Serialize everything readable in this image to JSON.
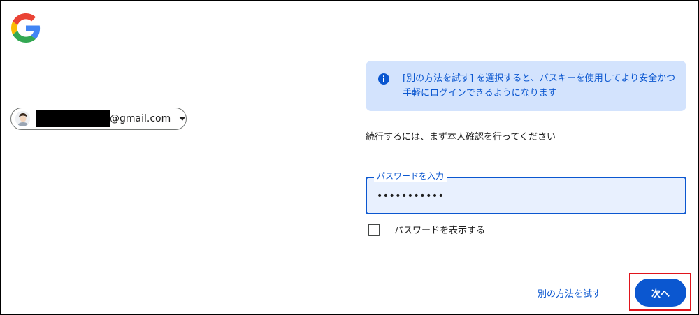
{
  "account": {
    "email_suffix": "@gmail.com",
    "avatar_icon": "user-avatar-icon",
    "dropdown_icon": "chevron-down-icon"
  },
  "info": {
    "icon": "info-icon",
    "text": "[別の方法を試す] を選択すると、パスキーを使用してより安全かつ手軽にログインできるようになります"
  },
  "subtitle": "続行するには、まず本人確認を行ってください",
  "password": {
    "label": "パスワードを入力",
    "value": "•••••••••••"
  },
  "show_password": {
    "label": "パスワードを表示する",
    "checked": false
  },
  "actions": {
    "try_another_label": "別の方法を試す",
    "next_label": "次へ"
  },
  "colors": {
    "accent": "#0b57d0",
    "info_bg": "#d3e3fd",
    "highlight": "#e0141c"
  }
}
